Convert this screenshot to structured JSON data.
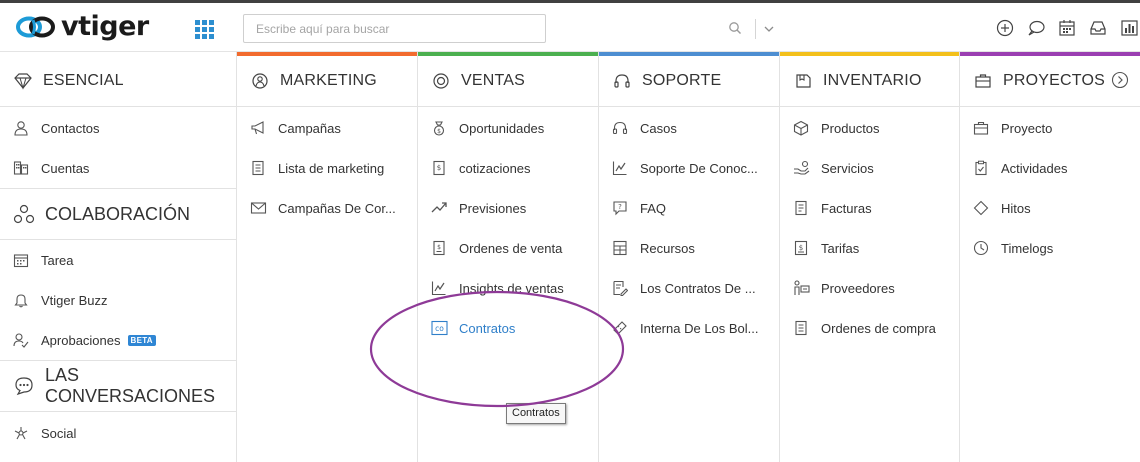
{
  "app": {
    "logo_text": "vtiger"
  },
  "search": {
    "placeholder": "Escribe aquí para buscar"
  },
  "toolbar_icons": [
    "add-icon",
    "chat-icon",
    "calendar-icon",
    "inbox-icon",
    "reports-icon"
  ],
  "columns": {
    "esencial": {
      "title": "ESENCIAL",
      "color": "#ffffff",
      "items": [
        {
          "label": "Contactos",
          "icon": "contact-icon"
        },
        {
          "label": "Cuentas",
          "icon": "building-icon"
        }
      ],
      "collab_title": "COLABORACIÓN",
      "collab_items": [
        {
          "label": "Tarea",
          "icon": "task-calendar-icon"
        },
        {
          "label": "Vtiger Buzz",
          "icon": "bell-icon"
        },
        {
          "label": "Aprobaciones",
          "icon": "approval-icon",
          "badge": "BETA"
        }
      ],
      "conv_title": "LAS CONVERSACIONES",
      "conv_items": [
        {
          "label": "Social",
          "icon": "social-icon"
        }
      ]
    },
    "marketing": {
      "title": "MARKETING",
      "color": "#f26b2e",
      "items": [
        {
          "label": "Campañas",
          "icon": "megaphone-icon"
        },
        {
          "label": "Lista de marketing",
          "icon": "list-icon"
        },
        {
          "label": "Campañas De Cor...",
          "icon": "email-icon"
        }
      ]
    },
    "ventas": {
      "title": "VENTAS",
      "color": "#4cb050",
      "items": [
        {
          "label": "Oportunidades",
          "icon": "money-bag-icon"
        },
        {
          "label": "cotizaciones",
          "icon": "quote-icon"
        },
        {
          "label": "Previsiones",
          "icon": "forecast-icon"
        },
        {
          "label": "Ordenes de venta",
          "icon": "sales-order-icon"
        },
        {
          "label": "Insights de ventas",
          "icon": "insights-icon"
        },
        {
          "label": "Contratos",
          "icon": "contract-icon"
        }
      ],
      "tooltip": "Contratos"
    },
    "soporte": {
      "title": "SOPORTE",
      "color": "#4d8ed1",
      "items": [
        {
          "label": "Casos",
          "icon": "headset-icon"
        },
        {
          "label": "Soporte De Conoc...",
          "icon": "knowledge-icon"
        },
        {
          "label": "FAQ",
          "icon": "faq-icon"
        },
        {
          "label": "Recursos",
          "icon": "resources-icon"
        },
        {
          "label": "Los Contratos De ...",
          "icon": "service-contract-icon"
        },
        {
          "label": "Interna De Los Bol...",
          "icon": "tickets-icon"
        }
      ]
    },
    "inventario": {
      "title": "INVENTARIO",
      "color": "#f3c01b",
      "items": [
        {
          "label": "Productos",
          "icon": "box-icon"
        },
        {
          "label": "Servicios",
          "icon": "services-icon"
        },
        {
          "label": "Facturas",
          "icon": "invoice-icon"
        },
        {
          "label": "Tarifas",
          "icon": "price-icon"
        },
        {
          "label": "Proveedores",
          "icon": "vendor-icon"
        },
        {
          "label": "Ordenes de compra",
          "icon": "purchase-order-icon"
        }
      ]
    },
    "proyectos": {
      "title": "PROYECTOS",
      "color": "#9b3fb2",
      "items": [
        {
          "label": "Proyecto",
          "icon": "briefcase-icon"
        },
        {
          "label": "Actividades",
          "icon": "clipboard-icon"
        },
        {
          "label": "Hitos",
          "icon": "diamond-icon"
        },
        {
          "label": "Timelogs",
          "icon": "clock-icon"
        }
      ]
    }
  },
  "annotation_color": "#8e3a97"
}
